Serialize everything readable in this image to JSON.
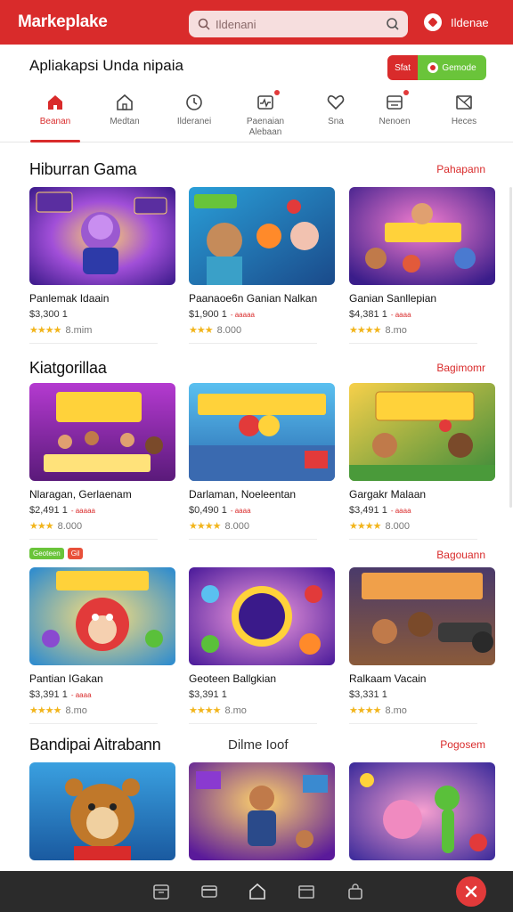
{
  "header": {
    "brand": "Markeplake",
    "search_placeholder": "Ildenani",
    "account_label": "Ildenae"
  },
  "subheader": {
    "title": "Apliakapsi Unda nipaia",
    "cta_left": "Sfat",
    "cta_right": "Gemode"
  },
  "categories": [
    {
      "label": "Beanan",
      "icon": "home-icon"
    },
    {
      "label": "Medtan",
      "icon": "house-icon"
    },
    {
      "label": "Ilderanei",
      "icon": "clock-icon"
    },
    {
      "label": "Paenaian Alebaan",
      "icon": "pulse-icon"
    },
    {
      "label": "Sna",
      "icon": "heart-icon"
    },
    {
      "label": "Nenoen",
      "icon": "inbox-icon"
    },
    {
      "label": "Heces",
      "icon": "map-icon"
    }
  ],
  "sections": [
    {
      "title": "Hiburran Gama",
      "more": "Pahapann",
      "items": [
        {
          "name": "Panlemak Idaain",
          "price": "$3,300 1",
          "tag": "",
          "rating": "★★★★",
          "meta": "8.mim"
        },
        {
          "name": "Paanaoe6n Ganian Nalkan",
          "price": "$1,900 1",
          "tag": "- aaaaa",
          "rating": "★★★",
          "meta": "8.000"
        },
        {
          "name": "Ganian Sanllepian",
          "price": "$4,381 1",
          "tag": "- aaaa",
          "rating": "★★★★",
          "meta": "8.mo"
        }
      ]
    },
    {
      "title": "Kiatgorillaa",
      "more": "Bagimomr",
      "items": [
        {
          "name": "Nlaragan, Gerlaenam",
          "price": "$2,491 1",
          "tag": "- aaaaa",
          "rating": "★★★",
          "meta": "8.000"
        },
        {
          "name": "Darlaman, Noeleentan",
          "price": "$0,490 1",
          "tag": "- aaaa",
          "rating": "★★★★",
          "meta": "8.000"
        },
        {
          "name": "Gargakr Malaan",
          "price": "$3,491 1",
          "tag": "- aaaa",
          "rating": "★★★★",
          "meta": "8.000"
        }
      ]
    },
    {
      "title": "",
      "more": "Bagouann",
      "badges": [
        "Geoteen",
        "Gil"
      ],
      "items": [
        {
          "name": "Pantian IGakan",
          "price": "$3,391 1",
          "tag": "- aaaa",
          "rating": "★★★★",
          "meta": "8.mo"
        },
        {
          "name": "Geoteen Ballgkian",
          "price": "$3,391 1",
          "tag": "",
          "rating": "★★★★",
          "meta": "8.mo"
        },
        {
          "name": "Ralkaam Vacain",
          "price": "$3,331 1",
          "tag": "",
          "rating": "★★★★",
          "meta": "8.mo"
        }
      ]
    },
    {
      "title": "Bandipai Aitrabann",
      "mid": "Dilme Ioof",
      "more": "Pogosem",
      "items": [
        {
          "name": "",
          "price": "",
          "tag": "",
          "rating": "",
          "meta": ""
        },
        {
          "name": "",
          "price": "",
          "tag": "",
          "rating": "",
          "meta": ""
        },
        {
          "name": "",
          "price": "",
          "tag": "",
          "rating": "",
          "meta": ""
        }
      ]
    }
  ],
  "bottom_nav": [
    "calendar-icon",
    "card-icon",
    "home-icon",
    "store-icon",
    "bag-icon"
  ],
  "fab_icon": "close-icon",
  "colors": {
    "brand": "#d92b2b",
    "accent_green": "#6ac43a",
    "star": "#f2b51c",
    "bottom": "#2b2b2b"
  }
}
